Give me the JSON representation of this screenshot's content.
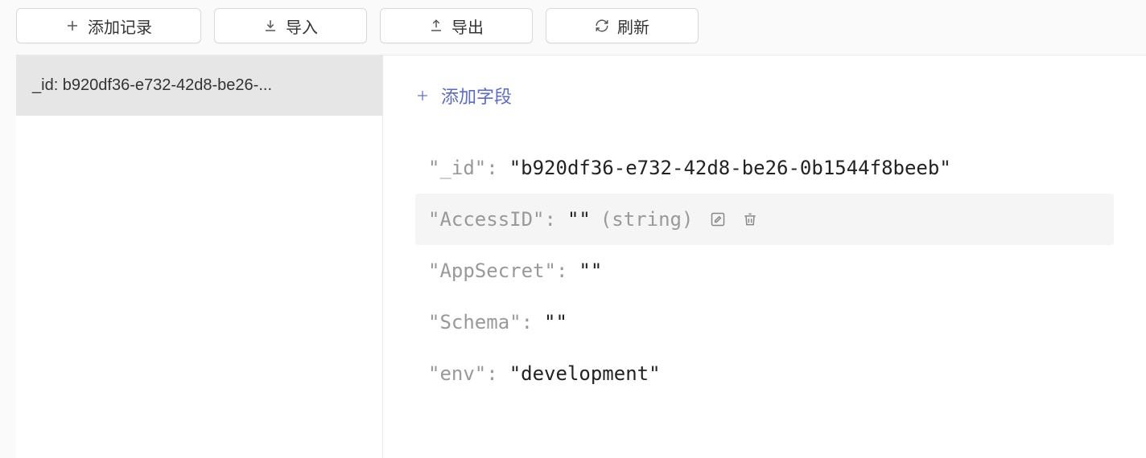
{
  "toolbar": {
    "add_record": "添加记录",
    "import": "导入",
    "export": "导出",
    "refresh": "刷新"
  },
  "sidebar": {
    "records": [
      {
        "label": "_id: b920df36-e732-42d8-be26-..."
      }
    ]
  },
  "detail": {
    "add_field_label": "添加字段",
    "fields": [
      {
        "key": "\"_id\"",
        "value": "\"b920df36-e732-42d8-be26-0b1544f8beeb\"",
        "type": null,
        "hovered": false
      },
      {
        "key": "\"AccessID\"",
        "value": "\"\"",
        "type": "(string)",
        "hovered": true
      },
      {
        "key": "\"AppSecret\"",
        "value": "\"\"",
        "type": null,
        "hovered": false
      },
      {
        "key": "\"Schema\"",
        "value": "\"\"",
        "type": null,
        "hovered": false
      },
      {
        "key": "\"env\"",
        "value": "\"development\"",
        "type": null,
        "hovered": false
      }
    ]
  }
}
